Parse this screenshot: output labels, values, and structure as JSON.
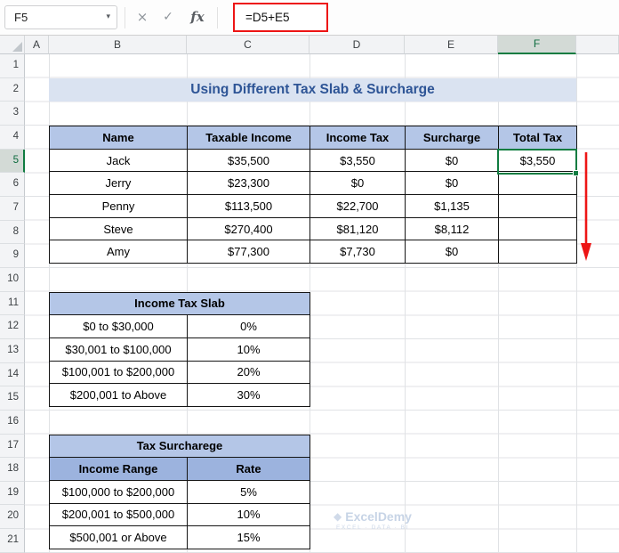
{
  "formula_bar": {
    "name_box_value": "F5",
    "formula": "=D5+E5",
    "icons": {
      "chevron_down": "▾",
      "cancel": "×",
      "enter": "✓",
      "insert_function": "fx"
    }
  },
  "sheet": {
    "column_letters": [
      "A",
      "B",
      "C",
      "D",
      "E",
      "F"
    ],
    "row_numbers": [
      "1",
      "2",
      "3",
      "4",
      "5",
      "6",
      "7",
      "8",
      "9",
      "10",
      "11",
      "12",
      "13",
      "14",
      "15",
      "16",
      "17",
      "18",
      "19",
      "20",
      "21"
    ],
    "selected_cell": "F5"
  },
  "title_banner": {
    "text": "Using Different Tax Slab & Surcharge"
  },
  "main_table": {
    "headers": [
      "Name",
      "Taxable Income",
      "Income Tax",
      "Surcharge",
      "Total Tax"
    ],
    "rows": [
      [
        "Jack",
        "$35,500",
        "$3,550",
        "$0",
        "$3,550"
      ],
      [
        "Jerry",
        "$23,300",
        "$0",
        "$0",
        ""
      ],
      [
        "Penny",
        "$113,500",
        "$22,700",
        "$1,135",
        ""
      ],
      [
        "Steve",
        "$270,400",
        "$81,120",
        "$8,112",
        ""
      ],
      [
        "Amy",
        "$77,300",
        "$7,730",
        "$0",
        ""
      ]
    ]
  },
  "tax_slab_table": {
    "title": "Income Tax Slab",
    "rows": [
      [
        "$0 to $30,000",
        "0%"
      ],
      [
        "$30,001 to $100,000",
        "10%"
      ],
      [
        "$100,001 to $200,000",
        "20%"
      ],
      [
        "$200,001 to Above",
        "30%"
      ]
    ]
  },
  "surcharge_table": {
    "title": "Tax Surcharege",
    "headers": [
      "Income Range",
      "Rate"
    ],
    "rows": [
      [
        "$100,000 to $200,000",
        "5%"
      ],
      [
        "$200,001 to $500,000",
        "10%"
      ],
      [
        "$500,001 or Above",
        "15%"
      ]
    ]
  },
  "watermark": {
    "logo_icon": "◆",
    "brand": "ExcelDemy",
    "tagline": "EXCEL · DATA · BI"
  },
  "colors": {
    "header_fill": "#b4c6e7",
    "subheader_fill": "#9cb3de",
    "title_fill": "#dae3f1",
    "title_text": "#2e5596",
    "accent_red": "#ed1515",
    "selection_green": "#107c41",
    "grid_line": "#e0e2e5",
    "table_border": "#151515"
  }
}
